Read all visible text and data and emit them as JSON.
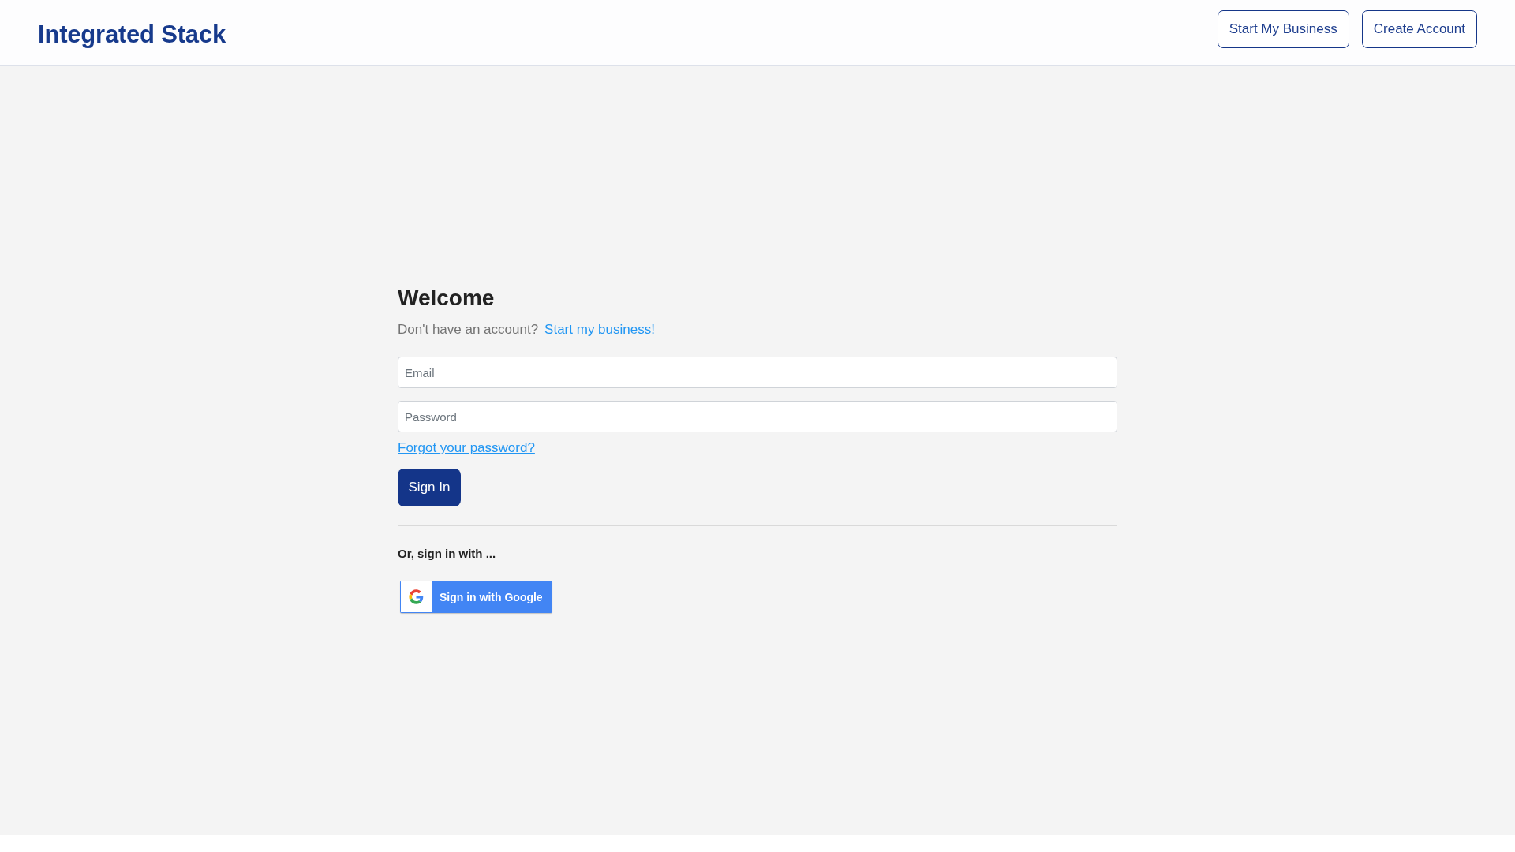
{
  "header": {
    "logo": "Integrated Stack",
    "buttons": [
      "Start My Business",
      "Create Account"
    ]
  },
  "login": {
    "title": "Welcome",
    "prompt": "Don't have an account?",
    "prompt_link": "Start my business!",
    "fields": [
      {
        "placeholder": "Email"
      },
      {
        "placeholder": "Password"
      }
    ],
    "forgot_link": "Forgot your password?",
    "submit": "Sign In",
    "alt_heading": "Or, sign in with ...",
    "google_button": "Sign in with Google"
  }
}
